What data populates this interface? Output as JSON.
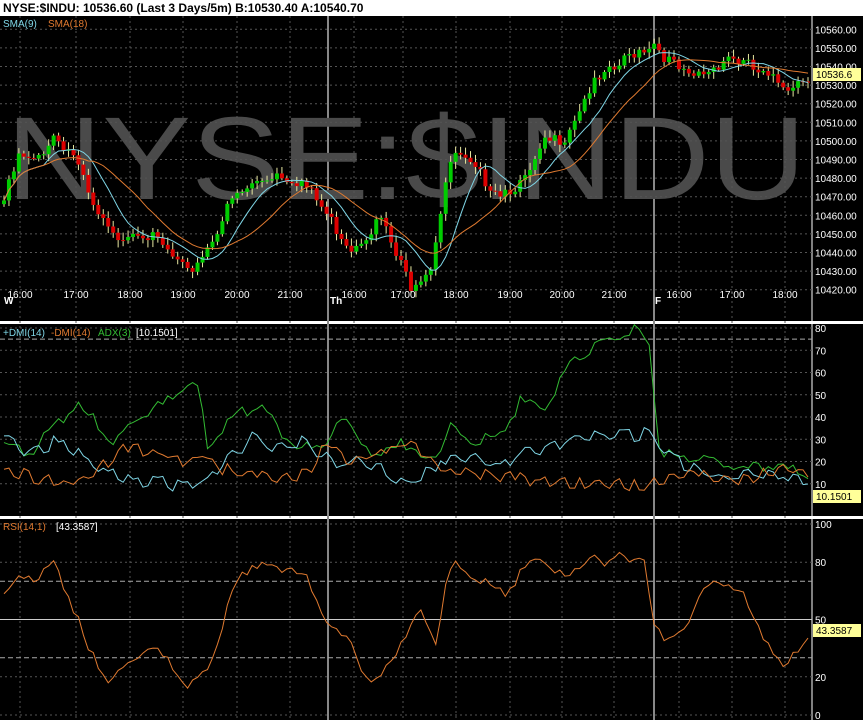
{
  "header": {
    "title": "NYSE:$INDU: 10536.60 (Last 3 Days/5m)  B:10530.40 A:10540.70"
  },
  "chart_data": [
    {
      "type": "candlestick",
      "watermark": "NYSE:$INDU",
      "legend": [
        {
          "name": "SMA(9)",
          "color": "#7fd6e6"
        },
        {
          "name": "SMA(18)",
          "color": "#e07a30"
        }
      ],
      "ylim": [
        10415,
        10565
      ],
      "yticks": [
        10420,
        10430,
        10440,
        10450,
        10460,
        10470,
        10480,
        10490,
        10500,
        10510,
        10520,
        10530,
        10540,
        10550,
        10560
      ],
      "last_value_label": "10536.6",
      "last_value": 10536.6,
      "day_labels": [
        "W",
        "Th",
        "F"
      ],
      "time_labels": [
        "16:00",
        "17:00",
        "18:00",
        "19:00",
        "20:00",
        "21:00",
        "16:00",
        "17:00",
        "18:00",
        "19:00",
        "20:00",
        "21:00",
        "16:00",
        "17:00",
        "18:00"
      ],
      "close_anchors": [
        [
          0,
          10470
        ],
        [
          3,
          10493
        ],
        [
          6,
          10490
        ],
        [
          10,
          10505
        ],
        [
          14,
          10495
        ],
        [
          18,
          10465
        ],
        [
          22,
          10450
        ],
        [
          27,
          10455
        ],
        [
          32,
          10445
        ],
        [
          37,
          10430
        ],
        [
          41,
          10445
        ],
        [
          46,
          10470
        ],
        [
          51,
          10480
        ],
        [
          55,
          10485
        ],
        [
          60,
          10480
        ],
        [
          63,
          10470
        ],
        [
          67,
          10455
        ],
        [
          70,
          10445
        ],
        [
          74,
          10455
        ],
        [
          76,
          10460
        ],
        [
          79,
          10440
        ],
        [
          82,
          10425
        ],
        [
          86,
          10435
        ],
        [
          89,
          10480
        ],
        [
          91,
          10495
        ],
        [
          95,
          10485
        ],
        [
          100,
          10475
        ],
        [
          105,
          10480
        ],
        [
          109,
          10500
        ],
        [
          113,
          10505
        ],
        [
          118,
          10530
        ],
        [
          123,
          10540
        ],
        [
          127,
          10550
        ],
        [
          131,
          10555
        ],
        [
          134,
          10545
        ],
        [
          138,
          10535
        ],
        [
          142,
          10540
        ],
        [
          146,
          10548
        ],
        [
          150,
          10542
        ],
        [
          154,
          10535
        ],
        [
          158,
          10532
        ],
        [
          162,
          10537
        ]
      ],
      "colors": {
        "up": "#00cc00",
        "down": "#dd0000"
      }
    },
    {
      "type": "line",
      "legend": [
        {
          "name": "+DMI(14)",
          "color": "#7fd6e6"
        },
        {
          "name": "-DMI(14)",
          "color": "#e07a30"
        },
        {
          "name": "ADX(3)",
          "color": "#33bb33"
        }
      ],
      "last_value_label": "[10.1501]",
      "last_value": 10.1501,
      "ylim": [
        0,
        80
      ],
      "yticks": [
        10,
        20,
        30,
        40,
        50,
        60,
        70,
        80
      ],
      "dashed_levels": [
        75
      ],
      "series": [
        {
          "name": "ADX(3)",
          "color": "#33bb33",
          "anchors": [
            [
              0,
              30
            ],
            [
              5,
              25
            ],
            [
              10,
              36
            ],
            [
              14,
              47
            ],
            [
              18,
              40
            ],
            [
              22,
              30
            ],
            [
              27,
              42
            ],
            [
              32,
              47
            ],
            [
              37,
              58
            ],
            [
              39,
              55
            ],
            [
              41,
              30
            ],
            [
              46,
              40
            ],
            [
              51,
              48
            ],
            [
              56,
              35
            ],
            [
              60,
              27
            ],
            [
              64,
              28
            ],
            [
              68,
              40
            ],
            [
              72,
              32
            ],
            [
              75,
              22
            ],
            [
              80,
              32
            ],
            [
              84,
              22
            ],
            [
              87,
              25
            ],
            [
              90,
              36
            ],
            [
              95,
              30
            ],
            [
              100,
              33
            ],
            [
              104,
              48
            ],
            [
              109,
              45
            ],
            [
              113,
              62
            ],
            [
              118,
              72
            ],
            [
              123,
              77
            ],
            [
              127,
              80
            ],
            [
              130,
              75
            ],
            [
              132,
              28
            ],
            [
              136,
              22
            ],
            [
              140,
              24
            ],
            [
              145,
              20
            ],
            [
              150,
              18
            ],
            [
              154,
              20
            ],
            [
              158,
              18
            ],
            [
              162,
              15
            ]
          ]
        },
        {
          "name": "+DMI(14)",
          "color": "#7fd6e6",
          "anchors": [
            [
              0,
              33
            ],
            [
              5,
              25
            ],
            [
              10,
              30
            ],
            [
              15,
              25
            ],
            [
              20,
              18
            ],
            [
              26,
              13
            ],
            [
              32,
              12
            ],
            [
              36,
              10
            ],
            [
              40,
              12
            ],
            [
              45,
              22
            ],
            [
              50,
              32
            ],
            [
              55,
              28
            ],
            [
              60,
              30
            ],
            [
              64,
              25
            ],
            [
              68,
              20
            ],
            [
              72,
              22
            ],
            [
              76,
              18
            ],
            [
              80,
              12
            ],
            [
              84,
              14
            ],
            [
              88,
              22
            ],
            [
              92,
              24
            ],
            [
              96,
              22
            ],
            [
              100,
              20
            ],
            [
              105,
              25
            ],
            [
              109,
              26
            ],
            [
              113,
              30
            ],
            [
              117,
              33
            ],
            [
              121,
              33
            ],
            [
              125,
              33
            ],
            [
              130,
              34
            ],
            [
              133,
              26
            ],
            [
              137,
              20
            ],
            [
              142,
              16
            ],
            [
              147,
              14
            ],
            [
              152,
              17
            ],
            [
              157,
              15
            ],
            [
              162,
              12
            ]
          ]
        },
        {
          "name": "-DMI(14)",
          "color": "#e07a30",
          "anchors": [
            [
              0,
              18
            ],
            [
              5,
              15
            ],
            [
              10,
              12
            ],
            [
              15,
              13
            ],
            [
              20,
              20
            ],
            [
              25,
              28
            ],
            [
              30,
              26
            ],
            [
              36,
              22
            ],
            [
              40,
              24
            ],
            [
              44,
              18
            ],
            [
              49,
              16
            ],
            [
              54,
              13
            ],
            [
              58,
              14
            ],
            [
              62,
              18
            ],
            [
              65,
              30
            ],
            [
              69,
              22
            ],
            [
              73,
              23
            ],
            [
              77,
              26
            ],
            [
              81,
              30
            ],
            [
              84,
              26
            ],
            [
              88,
              18
            ],
            [
              92,
              16
            ],
            [
              97,
              16
            ],
            [
              103,
              14
            ],
            [
              108,
              13
            ],
            [
              113,
              12
            ],
            [
              118,
              11
            ],
            [
              123,
              11
            ],
            [
              130,
              10
            ],
            [
              132,
              14
            ],
            [
              136,
              15
            ],
            [
              140,
              15
            ],
            [
              145,
              14
            ],
            [
              150,
              13
            ],
            [
              155,
              18
            ],
            [
              160,
              17
            ],
            [
              162,
              16
            ]
          ]
        }
      ]
    },
    {
      "type": "line",
      "legend": [
        {
          "name": "RSI(14,1)",
          "color": "#e07a30"
        }
      ],
      "last_value_label": "[43.3587]",
      "last_value": 43.3587,
      "ylim": [
        0,
        100
      ],
      "yticks": [
        0,
        20,
        50,
        80,
        100
      ],
      "dashed_levels": [
        30,
        70
      ],
      "solid_levels": [
        50
      ],
      "series": [
        {
          "name": "RSI(14,1)",
          "color": "#e07a30",
          "anchors": [
            [
              0,
              65
            ],
            [
              4,
              75
            ],
            [
              7,
              73
            ],
            [
              10,
              80
            ],
            [
              13,
              65
            ],
            [
              17,
              35
            ],
            [
              21,
              20
            ],
            [
              25,
              28
            ],
            [
              29,
              38
            ],
            [
              33,
              30
            ],
            [
              37,
              18
            ],
            [
              40,
              22
            ],
            [
              43,
              40
            ],
            [
              46,
              65
            ],
            [
              50,
              82
            ],
            [
              54,
              78
            ],
            [
              58,
              80
            ],
            [
              61,
              72
            ],
            [
              64,
              55
            ],
            [
              67,
              45
            ],
            [
              70,
              38
            ],
            [
              73,
              22
            ],
            [
              75,
              18
            ],
            [
              78,
              30
            ],
            [
              81,
              45
            ],
            [
              84,
              55
            ],
            [
              87,
              40
            ],
            [
              89,
              70
            ],
            [
              91,
              80
            ],
            [
              94,
              75
            ],
            [
              97,
              70
            ],
            [
              101,
              65
            ],
            [
              105,
              78
            ],
            [
              108,
              83
            ],
            [
              111,
              78
            ],
            [
              114,
              72
            ],
            [
              118,
              86
            ],
            [
              121,
              78
            ],
            [
              124,
              88
            ],
            [
              127,
              80
            ],
            [
              129,
              82
            ],
            [
              131,
              50
            ],
            [
              134,
              40
            ],
            [
              137,
              45
            ],
            [
              140,
              65
            ],
            [
              143,
              70
            ],
            [
              146,
              70
            ],
            [
              149,
              65
            ],
            [
              151,
              50
            ],
            [
              154,
              40
            ],
            [
              157,
              25
            ],
            [
              160,
              35
            ],
            [
              162,
              43
            ]
          ]
        }
      ]
    }
  ]
}
